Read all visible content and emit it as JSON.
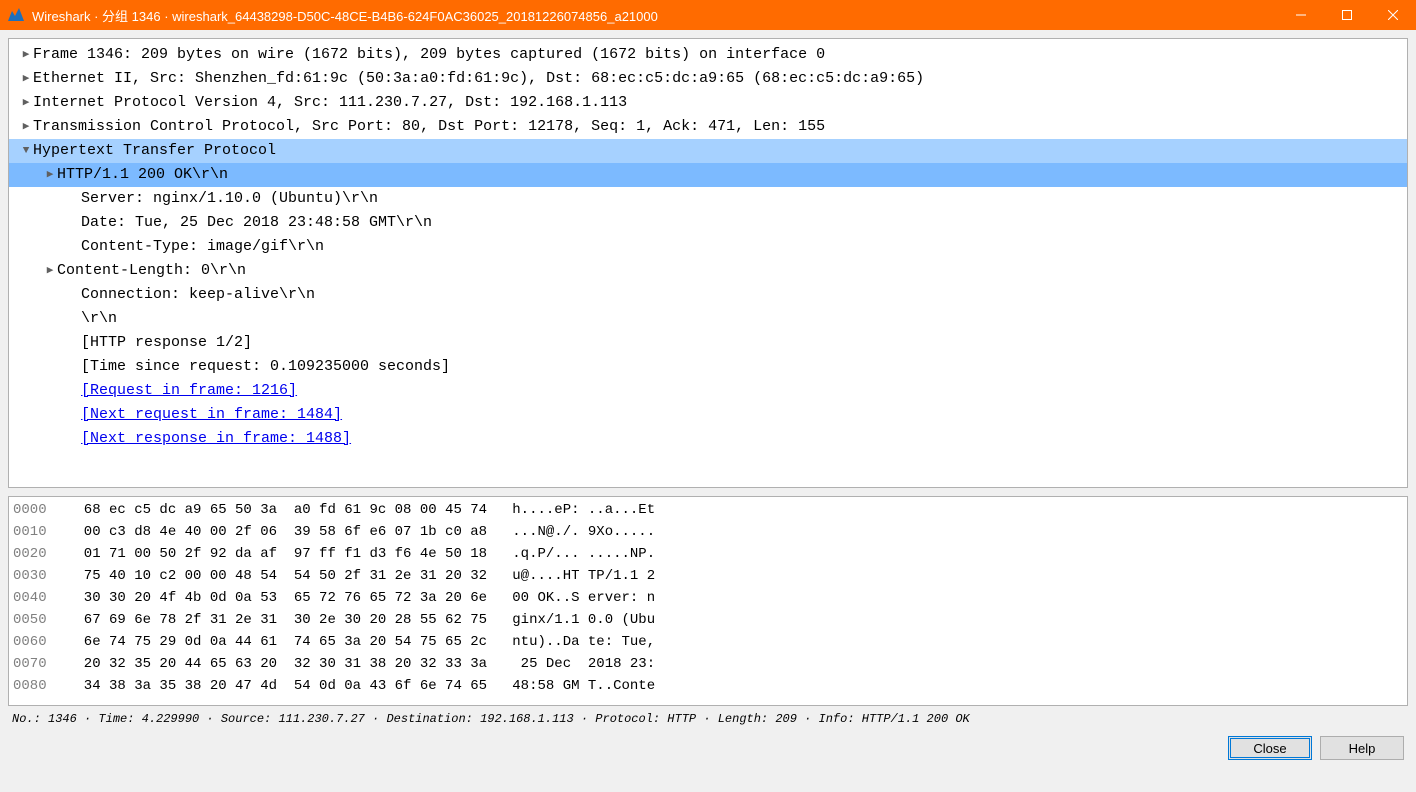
{
  "window": {
    "title": "Wireshark · 分组 1346 · wireshark_64438298-D50C-48CE-B4B6-624F0AC36025_20181226074856_a21000"
  },
  "tree": {
    "frame": "Frame 1346: 209 bytes on wire (1672 bits), 209 bytes captured (1672 bits) on interface 0",
    "eth": "Ethernet II, Src: Shenzhen_fd:61:9c (50:3a:a0:fd:61:9c), Dst: 68:ec:c5:dc:a9:65 (68:ec:c5:dc:a9:65)",
    "ip": "Internet Protocol Version 4, Src: 111.230.7.27, Dst: 192.168.1.113",
    "tcp": "Transmission Control Protocol, Src Port: 80, Dst Port: 12178, Seq: 1, Ack: 471, Len: 155",
    "http": "Hypertext Transfer Protocol",
    "http_status": "HTTP/1.1 200 OK\\r\\n",
    "server": "Server: nginx/1.10.0 (Ubuntu)\\r\\n",
    "date": "Date: Tue, 25 Dec 2018 23:48:58 GMT\\r\\n",
    "ctype": "Content-Type: image/gif\\r\\n",
    "clen": "Content-Length: 0\\r\\n",
    "conn": "Connection: keep-alive\\r\\n",
    "crlf": "\\r\\n",
    "resp12": "[HTTP response 1/2]",
    "timesince": "[Time since request: 0.109235000 seconds]",
    "reqframe": "[Request in frame: 1216]",
    "nextreq": "[Next request in frame: 1484]",
    "nextresp": "[Next response in frame: 1488]"
  },
  "hex": {
    "rows": [
      {
        "off": "0000",
        "b": "68 ec c5 dc a9 65 50 3a  a0 fd 61 9c 08 00 45 74",
        "a": "h....eP: ..a...Et"
      },
      {
        "off": "0010",
        "b": "00 c3 d8 4e 40 00 2f 06  39 58 6f e6 07 1b c0 a8",
        "a": "...N@./. 9Xo....."
      },
      {
        "off": "0020",
        "b": "01 71 00 50 2f 92 da af  97 ff f1 d3 f6 4e 50 18",
        "a": ".q.P/... .....NP."
      },
      {
        "off": "0030",
        "b": "75 40 10 c2 00 00 48 54  54 50 2f 31 2e 31 20 32",
        "a": "u@....HT TP/1.1 2"
      },
      {
        "off": "0040",
        "b": "30 30 20 4f 4b 0d 0a 53  65 72 76 65 72 3a 20 6e",
        "a": "00 OK..S erver: n"
      },
      {
        "off": "0050",
        "b": "67 69 6e 78 2f 31 2e 31  30 2e 30 20 28 55 62 75",
        "a": "ginx/1.1 0.0 (Ubu"
      },
      {
        "off": "0060",
        "b": "6e 74 75 29 0d 0a 44 61  74 65 3a 20 54 75 65 2c",
        "a": "ntu)..Da te: Tue,"
      },
      {
        "off": "0070",
        "b": "20 32 35 20 44 65 63 20  32 30 31 38 20 32 33 3a",
        "a": " 25 Dec  2018 23:"
      },
      {
        "off": "0080",
        "b": "34 38 3a 35 38 20 47 4d  54 0d 0a 43 6f 6e 74 65",
        "a": "48:58 GM T..Conte"
      }
    ]
  },
  "statusbar": "No.: 1346 · Time: 4.229990 · Source: 111.230.7.27 · Destination: 192.168.1.113 · Protocol: HTTP · Length: 209 · Info: HTTP/1.1 200 OK",
  "buttons": {
    "close": "Close",
    "help": "Help"
  }
}
